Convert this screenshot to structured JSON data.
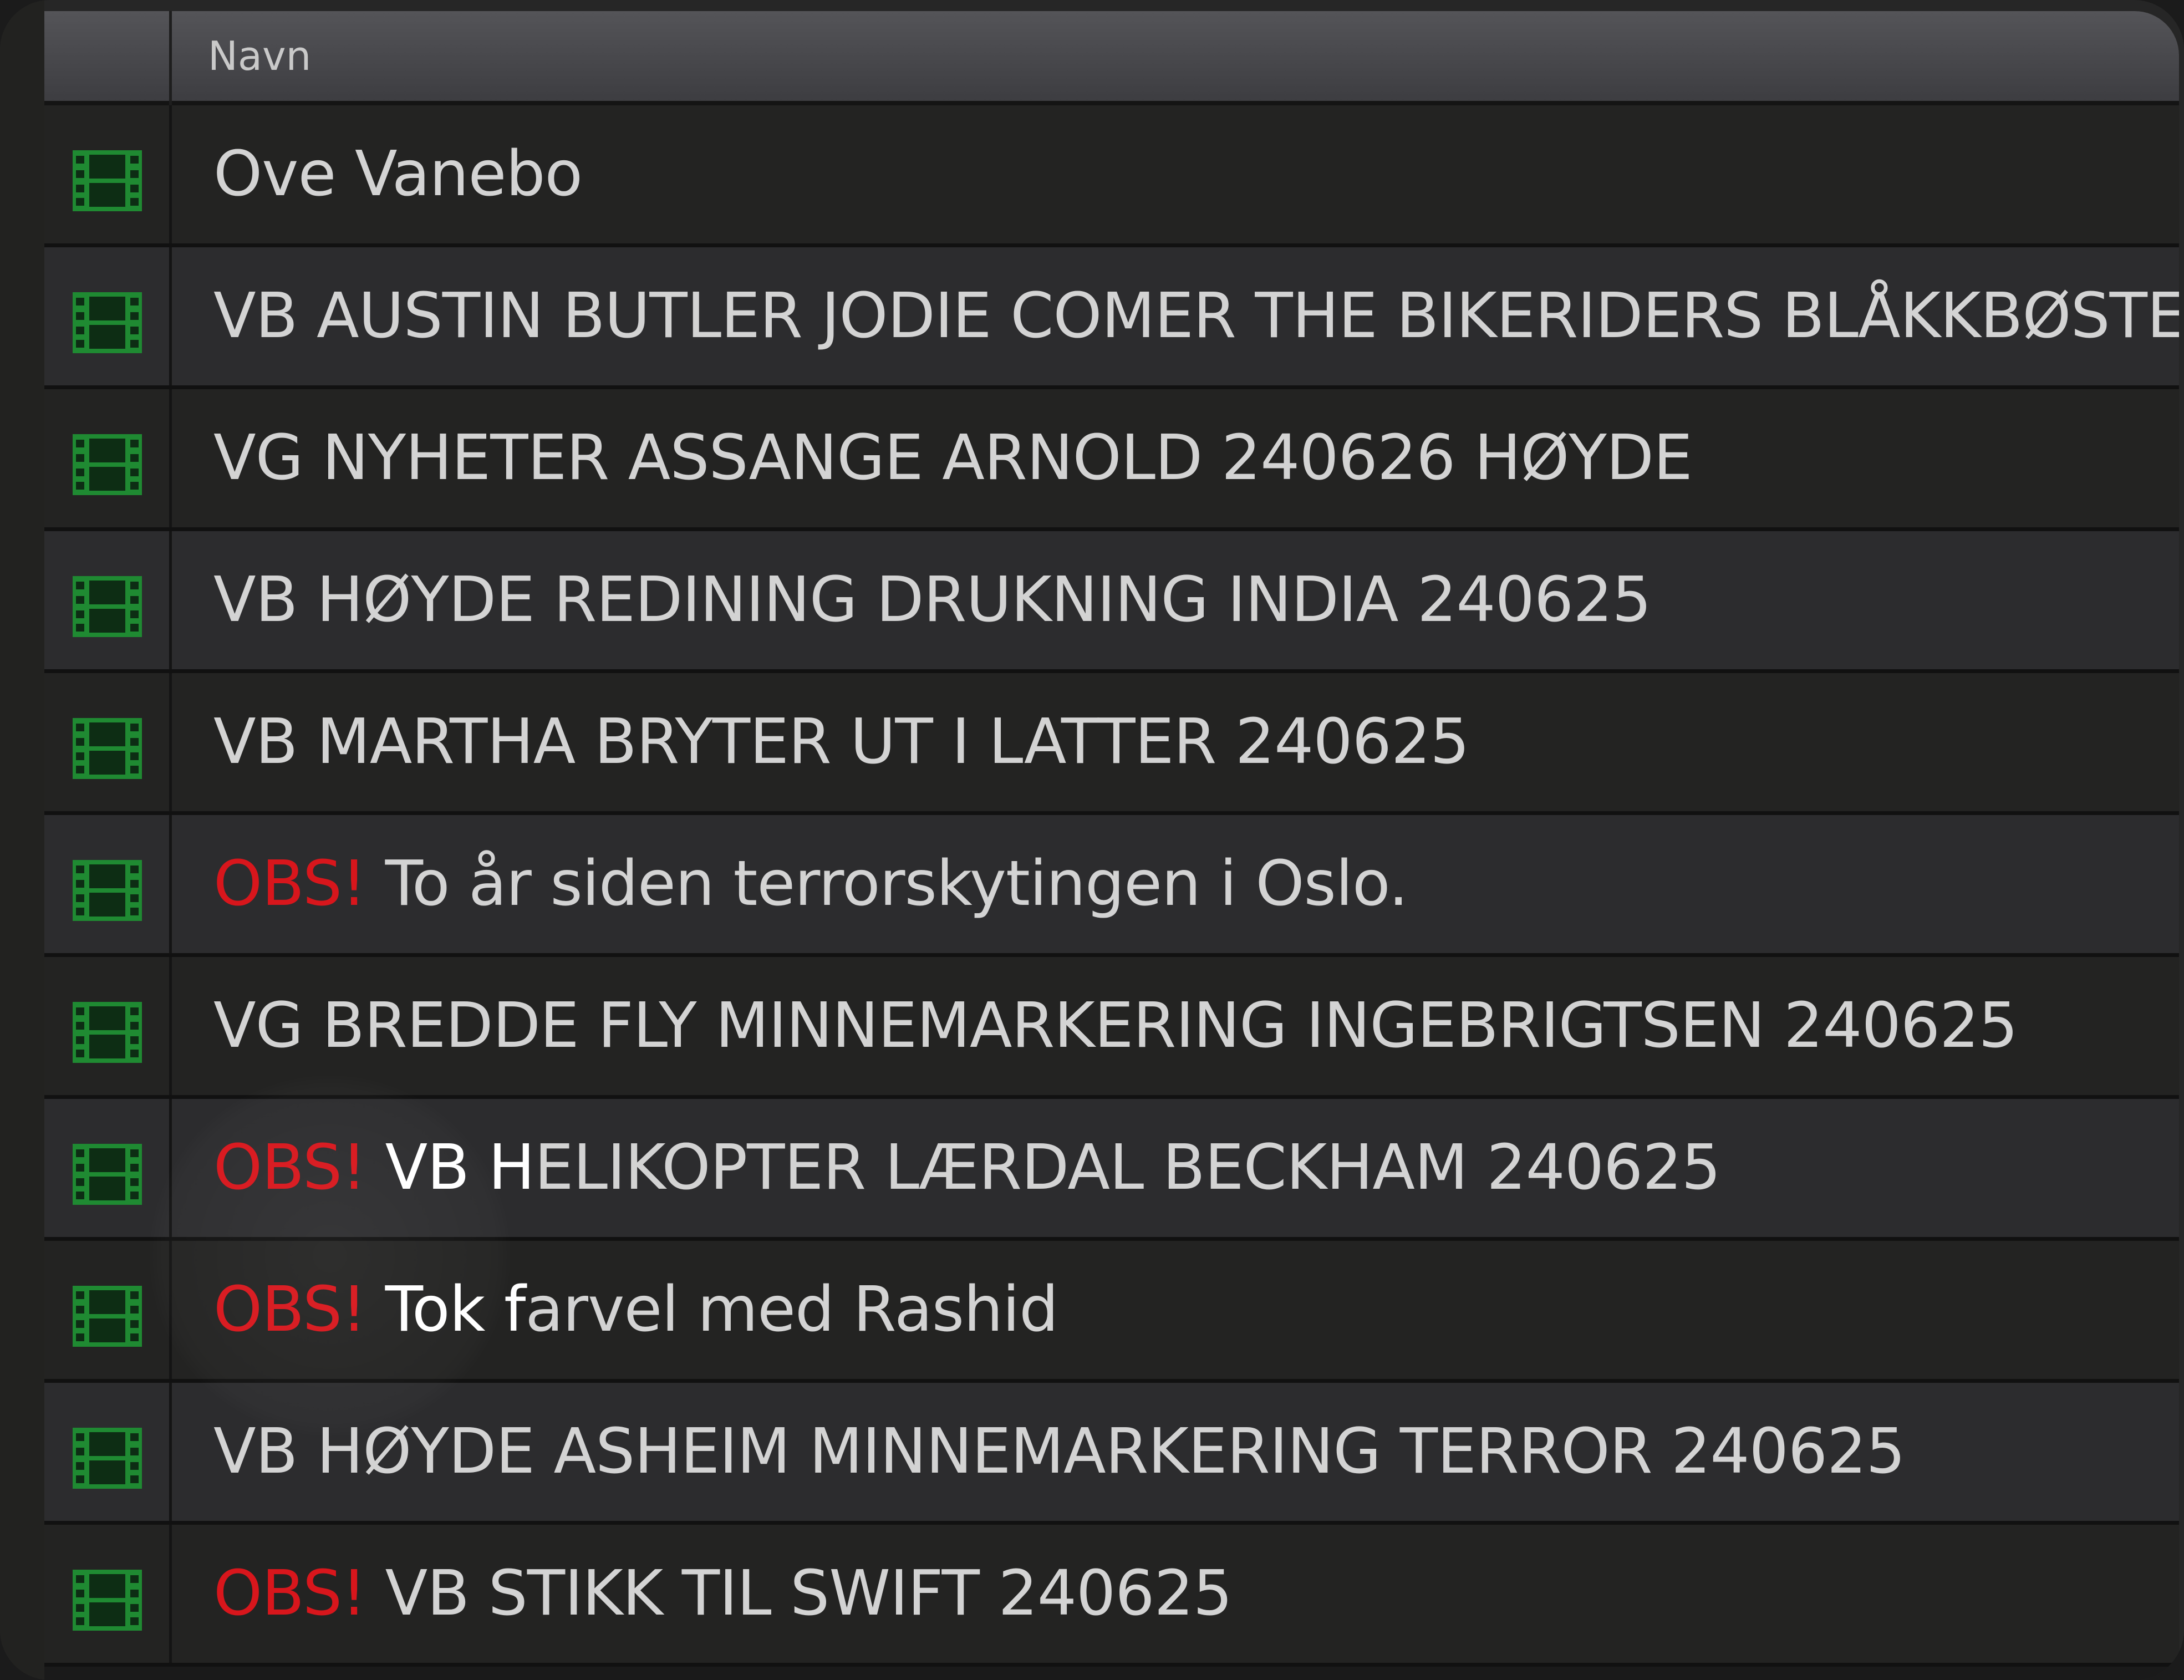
{
  "header": {
    "column_name_label": "Navn"
  },
  "icons": {
    "row_icon": "film-icon",
    "row_icon_color": "#1f8a32"
  },
  "colors": {
    "obs_prefix": "#d8161c",
    "row_text": "#d3d3d3"
  },
  "rows": [
    {
      "prefix": "",
      "highlight": "",
      "name": "Ove Vanebo"
    },
    {
      "prefix": "",
      "highlight": "",
      "name": "VB AUSTIN BUTLER JODIE COMER THE BIKERIDERS BLÅKKBØSTER"
    },
    {
      "prefix": "",
      "highlight": "",
      "name": "VG NYHETER ASSANGE ARNOLD 240626 HØYDE"
    },
    {
      "prefix": "",
      "highlight": "",
      "name": "VB HØYDE REDINING DRUKNING INDIA 240625"
    },
    {
      "prefix": "",
      "highlight": "",
      "name": "VB MARTHA BRYTER UT I LATTER 240625"
    },
    {
      "prefix": "OBS! ",
      "highlight": "",
      "name": "To år siden terrorskytingen i Oslo."
    },
    {
      "prefix": "",
      "highlight": "",
      "name": "VG BREDDE FLY MINNEMARKERING INGEBRIGTSEN 240625"
    },
    {
      "prefix": "OBS! ",
      "highlight": "VB H",
      "name": "ELIKOPTER LÆRDAL BECKHAM 240625"
    },
    {
      "prefix": "OBS! ",
      "highlight": "Tok f",
      "name": "arvel med Rashid"
    },
    {
      "prefix": "",
      "highlight": "",
      "name": "VB HØYDE ASHEIM MINNEMARKERING TERROR 240625"
    },
    {
      "prefix": "OBS! ",
      "highlight": "",
      "name": "VB STIKK TIL SWIFT 240625"
    }
  ]
}
